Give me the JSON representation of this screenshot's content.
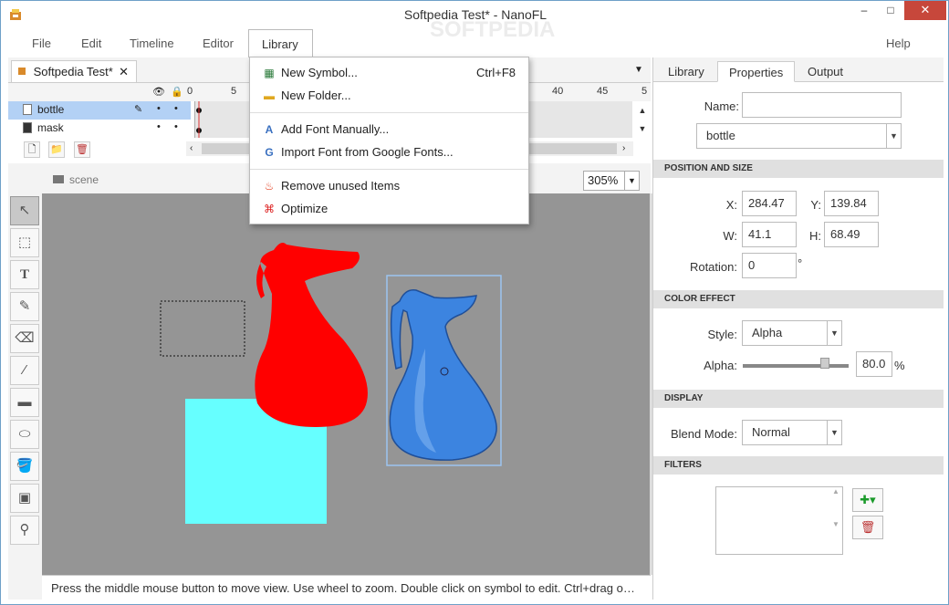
{
  "window": {
    "title": "Softpedia Test* - NanoFL",
    "min": "–",
    "max": "□",
    "close": "✕"
  },
  "menubar": {
    "file": "File",
    "edit": "Edit",
    "timeline": "Timeline",
    "editor": "Editor",
    "library": "Library",
    "help": "Help"
  },
  "document": {
    "tab": "Softpedia Test*",
    "close": "✕"
  },
  "timeline": {
    "ticks": [
      "0",
      "5",
      "40",
      "45",
      "5"
    ],
    "layers": [
      {
        "name": "bottle",
        "selected": true
      },
      {
        "name": "mask",
        "selected": false
      }
    ]
  },
  "stage": {
    "scene": "scene",
    "zoom": "305%"
  },
  "tools": [
    "select",
    "transform",
    "text",
    "pencil",
    "eraser",
    "line",
    "rectangle",
    "ellipse",
    "fill",
    "gradient",
    "eyedropper"
  ],
  "status": "Press the middle mouse button to move view. Use wheel to zoom. Double click on symbol to edit. Ctrl+drag o…",
  "right": {
    "tabs": [
      "Library",
      "Properties",
      "Output"
    ],
    "name_label": "Name:",
    "name_value": "",
    "symbol": "bottle",
    "sections": {
      "pos": "POSITION AND SIZE",
      "color": "COLOR EFFECT",
      "display": "DISPLAY",
      "filters": "FILTERS"
    },
    "x_label": "X:",
    "x": "284.47",
    "y_label": "Y:",
    "y": "139.84",
    "w_label": "W:",
    "w": "41.1",
    "h_label": "H:",
    "h": "68.49",
    "rot_label": "Rotation:",
    "rotation": "0",
    "deg": "°",
    "style_label": "Style:",
    "style": "Alpha",
    "alpha_label": "Alpha:",
    "alpha": "80.0",
    "alpha_level": 0.8,
    "pct": "%",
    "blend_label": "Blend Mode:",
    "blend": "Normal"
  },
  "library_menu": [
    {
      "label": "New Symbol...",
      "shortcut": "Ctrl+F8"
    },
    {
      "label": "New Folder...",
      "shortcut": ""
    },
    {
      "label": "Add Font Manually...",
      "shortcut": ""
    },
    {
      "label": "Import Font from Google Fonts...",
      "shortcut": ""
    },
    {
      "label": "Remove unused Items",
      "shortcut": ""
    },
    {
      "label": "Optimize",
      "shortcut": ""
    }
  ],
  "watermark": "SOFTPEDIA",
  "colors": {
    "red_jug": "#ff0000",
    "blue_jug": "#3c84e0",
    "cyan_rect": "#66ffff",
    "canvas": "#959595",
    "close_btn": "#c7473b"
  }
}
